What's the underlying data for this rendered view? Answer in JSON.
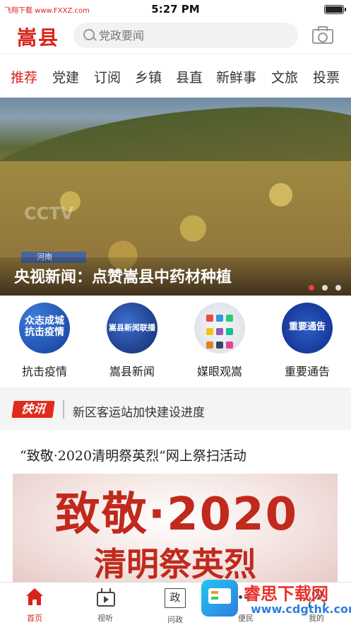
{
  "status_bar": {
    "time": "5:27 PM",
    "carrier": "飞翔下载 www.FXXZ.com"
  },
  "header": {
    "logo": "嵩县",
    "search_placeholder": "党政要闻"
  },
  "tabs": [
    {
      "label": "推荐",
      "active": true
    },
    {
      "label": "党建"
    },
    {
      "label": "订阅"
    },
    {
      "label": "乡镇"
    },
    {
      "label": "县直"
    },
    {
      "label": "新鲜事"
    },
    {
      "label": "文旅"
    },
    {
      "label": "投票"
    }
  ],
  "banner": {
    "title": "央视新闻：点赞嵩县中药材种植",
    "watermark": "CCTV",
    "region_tag": "河南",
    "pages": 3,
    "current_page": 1
  },
  "shortcuts": [
    {
      "label": "抗击疫情",
      "icon_text": "众志成城\n抗击疫情"
    },
    {
      "label": "嵩县新闻",
      "icon_text": "嵩县新闻联播"
    },
    {
      "label": "媒眼观嵩",
      "icon_text": ""
    },
    {
      "label": "重要通告",
      "icon_text": "重要通告"
    }
  ],
  "flash": {
    "badge": "快讯",
    "text": "新区客运站加快建设进度"
  },
  "article": {
    "title": "“致敬·2020清明祭英烈”网上祭扫活动",
    "image_line1": "致敬·2020",
    "image_line2": "清明祭英烈"
  },
  "bottom_nav": [
    {
      "label": "首页",
      "active": true
    },
    {
      "label": "视听"
    },
    {
      "label": "问政",
      "icon_char": "政"
    },
    {
      "label": "便民"
    },
    {
      "label": "我的"
    }
  ],
  "watermark": {
    "name": "睿思下载网",
    "url": "www.cdgthk.com"
  },
  "colors": {
    "brand": "#d8221a",
    "flash_badge": "#e02b1a",
    "dot_active": "#e94343"
  }
}
